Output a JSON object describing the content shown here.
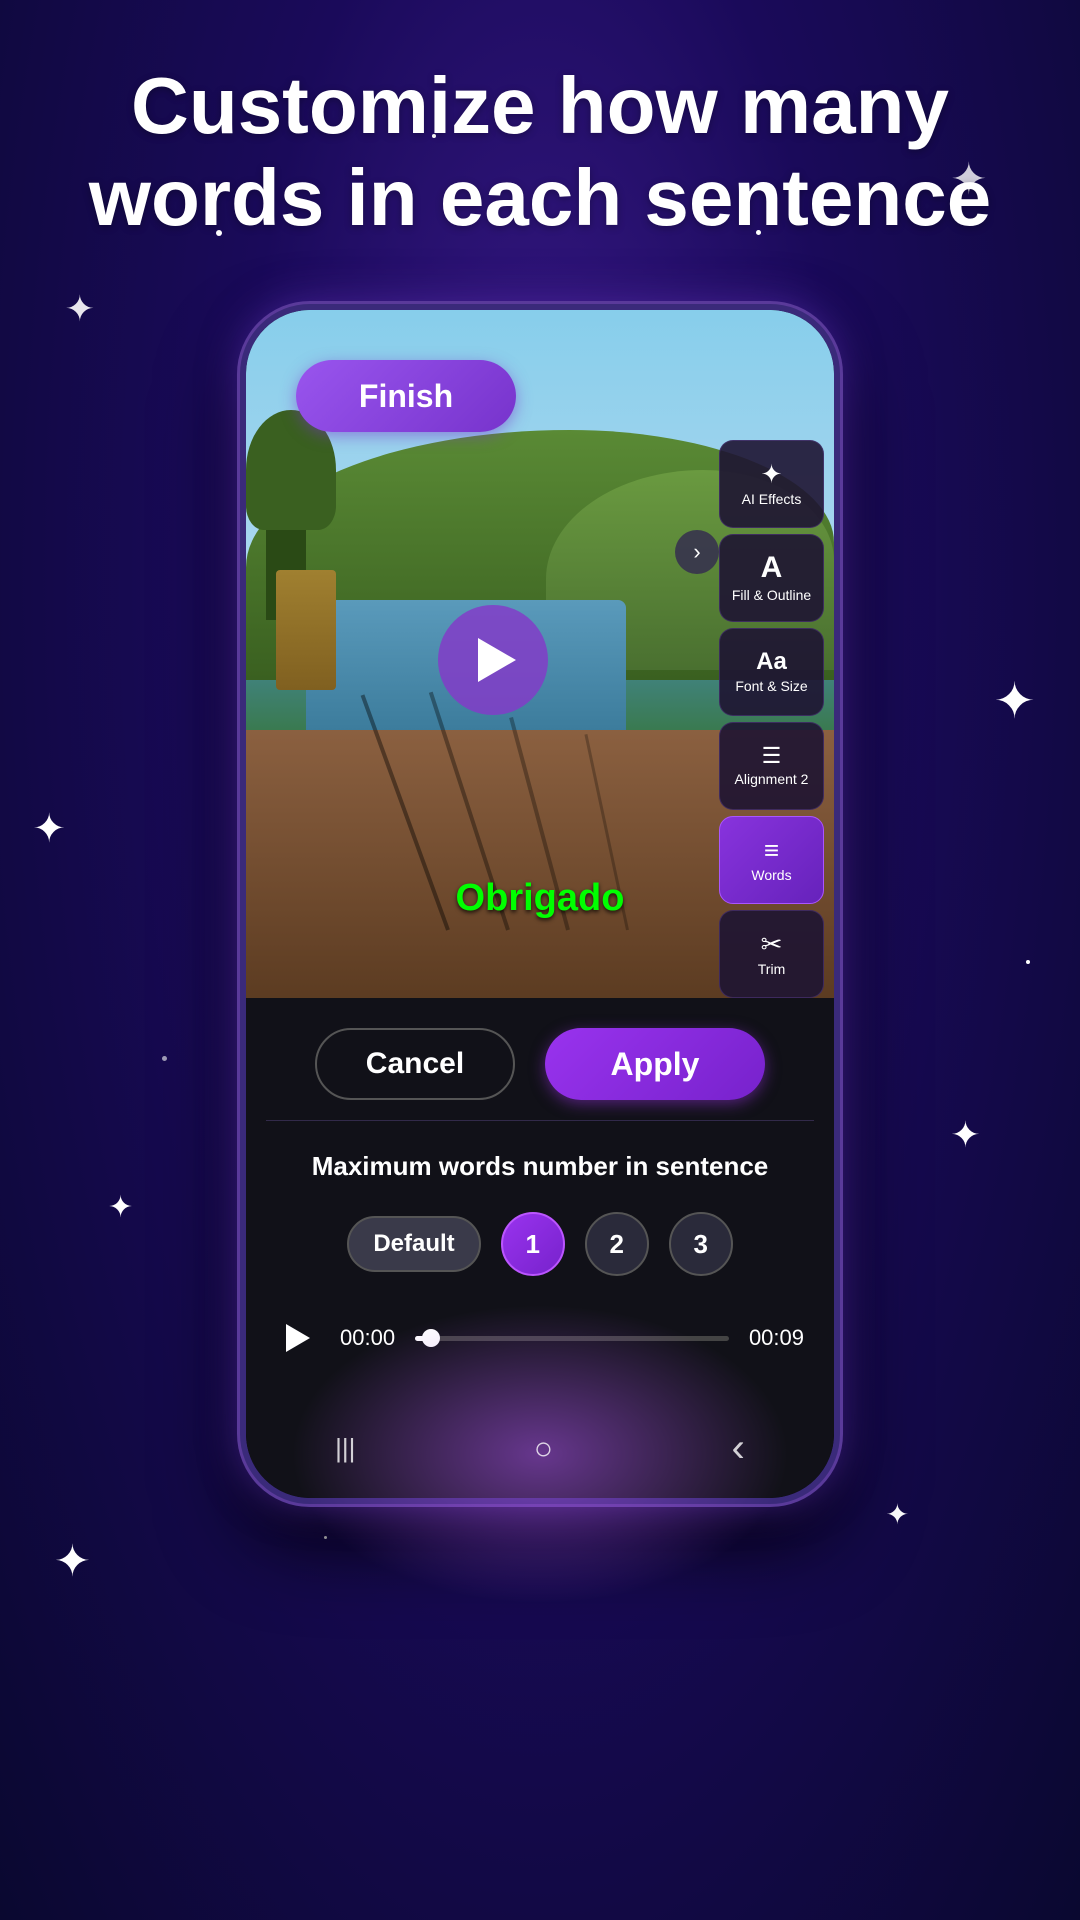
{
  "header": {
    "title": "Customize how many words in each sentence"
  },
  "finish_button": {
    "label": "Finish"
  },
  "toolbar": {
    "items": [
      {
        "id": "ai-effects",
        "icon": "✦",
        "label": "AI Effects",
        "active": false
      },
      {
        "id": "fill-outline",
        "icon": "A",
        "label": "Fill & Outline",
        "active": false
      },
      {
        "id": "font-size",
        "icon": "Aa",
        "label": "Font & Size",
        "active": false
      },
      {
        "id": "alignment",
        "icon": "⌃",
        "label": "Alignment 2",
        "active": false
      },
      {
        "id": "words",
        "icon": "≡",
        "label": "Words",
        "active": true
      },
      {
        "id": "trim",
        "icon": "✂",
        "label": "Trim",
        "active": false
      }
    ]
  },
  "video": {
    "overlay_text": "Obrigado",
    "play_visible": true
  },
  "bottom_panel": {
    "cancel_label": "Cancel",
    "apply_label": "Apply",
    "section_title": "Maximum words number in sentence",
    "options": [
      {
        "id": "default",
        "label": "Default",
        "selected": false
      },
      {
        "id": "1",
        "label": "1",
        "selected": true
      },
      {
        "id": "2",
        "label": "2",
        "selected": false
      },
      {
        "id": "3",
        "label": "3",
        "selected": false
      }
    ],
    "progress": {
      "current_time": "00:00",
      "end_time": "00:09",
      "percent": 5
    }
  },
  "phone_nav": {
    "back": "‹",
    "home": "○",
    "recents": "|||"
  }
}
